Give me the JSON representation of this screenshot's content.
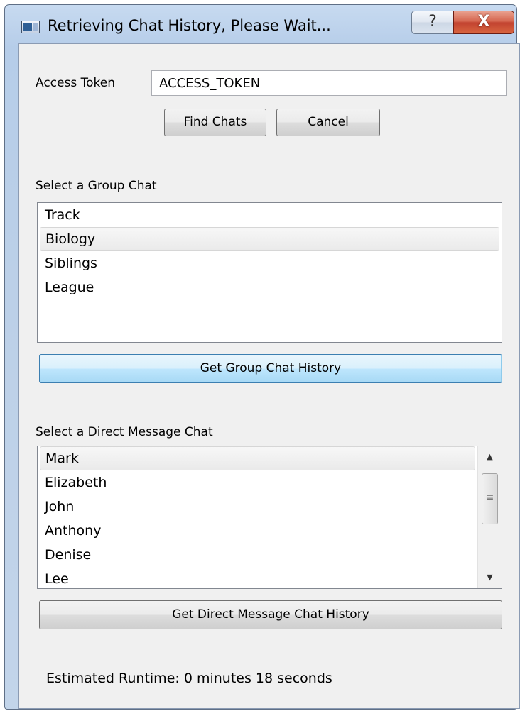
{
  "window": {
    "title": "Retrieving Chat History, Please Wait...",
    "help_glyph": "?",
    "close_glyph": "X"
  },
  "token": {
    "label": "Access Token",
    "value": "ACCESS_TOKEN"
  },
  "buttons": {
    "find_chats": "Find Chats",
    "cancel": "Cancel",
    "get_group_history": "Get Group Chat History",
    "get_dm_history": "Get Direct Message Chat History"
  },
  "group_chats": {
    "label": "Select a Group Chat",
    "items": [
      "Track",
      "Biology",
      "Siblings",
      "League"
    ],
    "selected": "Biology"
  },
  "dm_chats": {
    "label": "Select a Direct Message Chat",
    "items": [
      "Mark",
      "Elizabeth",
      "John",
      "Anthony",
      "Denise",
      "Lee"
    ],
    "selected": "Mark"
  },
  "status": {
    "runtime": "Estimated Runtime: 0 minutes 18 seconds"
  },
  "icons": {
    "scroll_up": "▲",
    "scroll_down": "▼",
    "scroll_grip": "≡"
  }
}
